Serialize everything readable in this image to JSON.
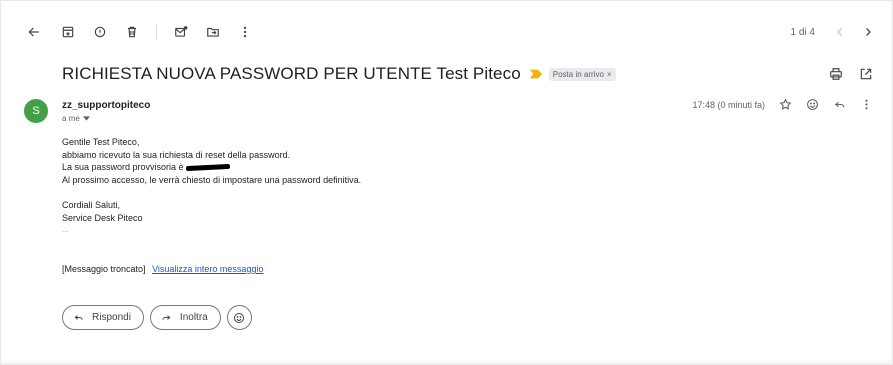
{
  "toolbar": {
    "page_count": "1 di 4"
  },
  "email": {
    "subject": "RICHIESTA NUOVA PASSWORD PER UTENTE Test Piteco",
    "label": "Posta in arrivo",
    "label_close": "×",
    "avatar_letter": "S",
    "avatar_color": "#43a047",
    "sender": "zz_supportopiteco",
    "recipient": "a me",
    "timestamp": "17:48 (0 minuti fa)",
    "body": {
      "greeting": "Gentile Test Piteco,",
      "line1": "abbiamo ricevuto la sua richiesta di reset della password.",
      "line2": "La sua password provvisoria è",
      "line3": "Al prossimo accesso, le verrà chiesto di impostare una password definitiva.",
      "closing1": "Cordiali Saluti,",
      "closing2": "Service Desk Piteco",
      "ellipsis": "..."
    },
    "truncated_text": "[Messaggio troncato]",
    "view_full_link": "Visualizza intero messaggio"
  },
  "actions": {
    "reply": "Rispondi",
    "forward": "Inoltra"
  },
  "colors": {
    "link": "#1a56c8",
    "importance": "#f4b400"
  }
}
